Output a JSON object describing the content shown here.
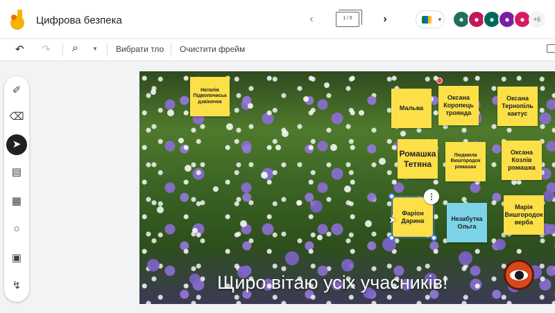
{
  "header": {
    "title": "Цифрова безпека",
    "frame_counter": "1 / 6",
    "extra_collaborators": "+6"
  },
  "toolbar": {
    "set_background_label": "Вибрати тло",
    "clear_frame_label": "Очистити фрейм"
  },
  "palette": {
    "tools": [
      "pen-icon",
      "eraser-icon",
      "select-icon",
      "sticky-note-icon",
      "image-icon",
      "circle-shape-icon",
      "text-box-icon",
      "laser-icon"
    ],
    "active_tool": "select-icon"
  },
  "canvas": {
    "welcome_text": "Щиро вітаю усіх учасників!",
    "notes": [
      {
        "text": "Наталія Підвопочиськ дзвіночок",
        "color": "#fde047"
      },
      {
        "text": "Мальва",
        "color": "#fde047"
      },
      {
        "text": "Оксана Коропець троянда",
        "color": "#fde047"
      },
      {
        "text": "Оксана Тернопіль кактус",
        "color": "#fde047"
      },
      {
        "text": "Ромашка Тетяна",
        "color": "#fde047"
      },
      {
        "text": "Людмила Вишгородок ромашка",
        "color": "#fde047"
      },
      {
        "text": "Оксана Козлів ромашка",
        "color": "#fde047"
      },
      {
        "text": "Фаріон Дарина",
        "color": "#fde047"
      },
      {
        "text": "Незабутка Ольга",
        "color": "#7dd3e8"
      },
      {
        "text": "Марія Вишгородок верба",
        "color": "#fde047"
      }
    ]
  },
  "colors": {
    "selection": "#4285f4",
    "yellow_note": "#fde047",
    "blue_note": "#7dd3e8"
  }
}
